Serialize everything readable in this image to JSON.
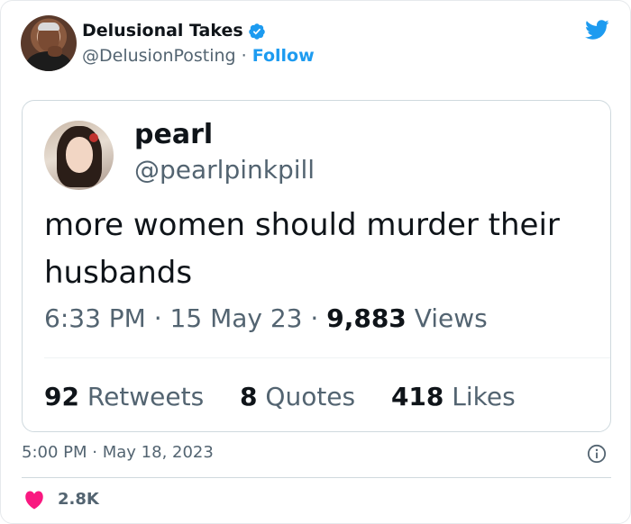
{
  "author": {
    "name": "Delusional Takes",
    "handle": "@DelusionPosting",
    "separator": "·",
    "follow_label": "Follow"
  },
  "quoted_tweet": {
    "name": "pearl",
    "handle": "@pearlpinkpill",
    "text": "more women should murder their husbands",
    "time": "6:33 PM",
    "date": "15 May 23",
    "views_count": "9,883",
    "views_label": "Views",
    "retweets_count": "92",
    "retweets_label": "Retweets",
    "quotes_count": "8",
    "quotes_label": "Quotes",
    "likes_count": "418",
    "likes_label": "Likes",
    "separator": "·"
  },
  "footer": {
    "time": "5:00 PM",
    "separator": "·",
    "date": "May 18, 2023",
    "likes": "2.8K"
  },
  "icons": {
    "verified": "verified-badge-icon",
    "platform": "bird-logo-icon",
    "info": "info-icon",
    "like": "heart-icon"
  },
  "colors": {
    "accent": "#1d9bf0",
    "text": "#0f1419",
    "secondary": "#536471",
    "heart": "#f91880"
  }
}
